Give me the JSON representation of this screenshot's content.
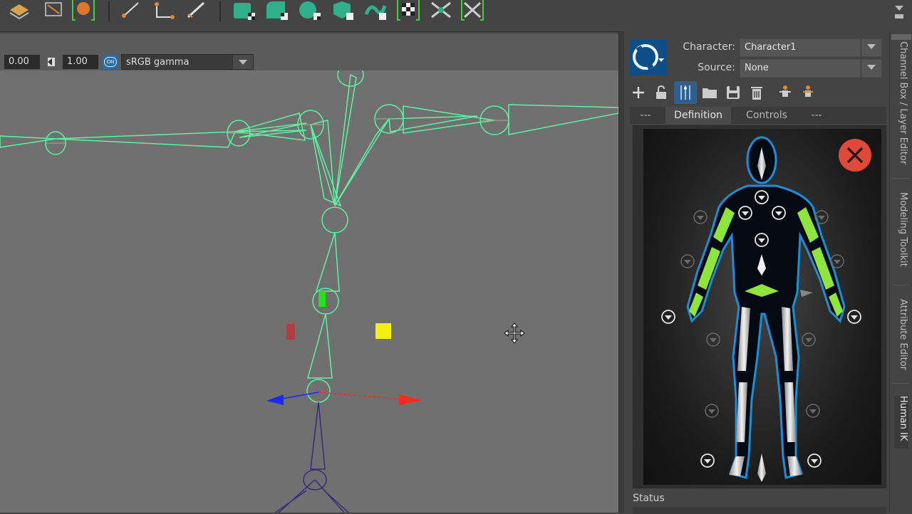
{
  "viewport_bar": {
    "exposure_value": "0.00",
    "gamma_value": "1.00",
    "colorspace_toggle": "ON",
    "colorspace": "sRGB gamma"
  },
  "hik_panel": {
    "character_label": "Character:",
    "character_value": "Character1",
    "source_label": "Source:",
    "source_value": "None",
    "tabs": [
      {
        "label": "---"
      },
      {
        "label": "Definition"
      },
      {
        "label": "Controls"
      },
      {
        "label": "---"
      }
    ],
    "status_label": "Status"
  },
  "side_tabs": [
    {
      "label": "Channel Box / Layer Editor"
    },
    {
      "label": "Modeling Toolkit"
    },
    {
      "label": "Attribute Editor"
    },
    {
      "label": "Human IK"
    }
  ],
  "colors": {
    "joint_green": "#5ef2a2",
    "limb_green": "#8ee63c",
    "close_red": "#e0493a",
    "selection_yellow": "#f5f011",
    "axis_red": "#ff2a1a",
    "axis_blue": "#1a2aff",
    "axis_green": "#23e023"
  },
  "icons": [
    "create-character-icon",
    "lock-icon",
    "skeleton-icon",
    "open-folder-icon",
    "save-icon",
    "delete-icon",
    "export-icon",
    "import-icon",
    "hik-logo-icon",
    "close-icon",
    "move-cursor-icon"
  ]
}
